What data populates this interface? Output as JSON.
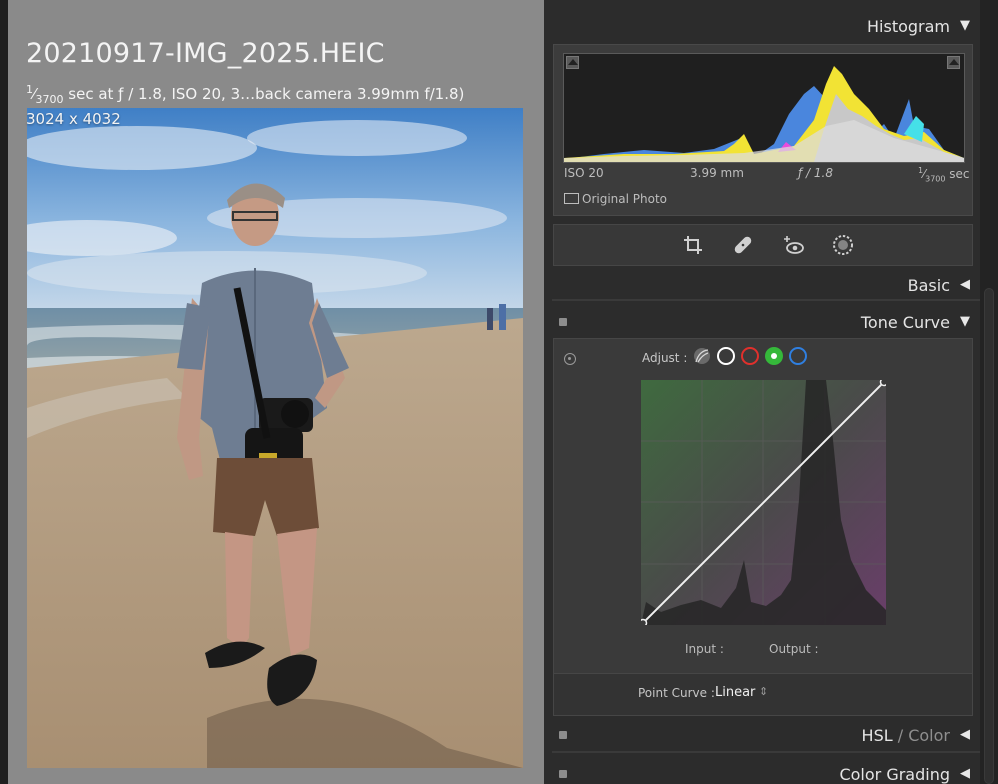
{
  "photo_info": {
    "filename": "20210917-IMG_2025.HEIC",
    "shutter_numerator": "1",
    "shutter_denominator": "3700",
    "exif_rest": " sec at ƒ / 1.8, ISO 20, 3…back camera 3.99mm f/1.8)",
    "dimensions": "3024 x 4032"
  },
  "panel": {
    "histogram": {
      "title": "Histogram",
      "iso": "ISO 20",
      "focal_length": "3.99 mm",
      "aperture": "ƒ / 1.8",
      "shutter_num": "1",
      "shutter_den": "3700",
      "shutter_unit": "sec",
      "original_photo_label": "Original Photo"
    },
    "tools": [
      "crop-icon",
      "healing-icon",
      "red-eye-icon",
      "masking-icon"
    ],
    "basic": {
      "title": "Basic"
    },
    "tone_curve": {
      "title": "Tone Curve",
      "adjust_label": "Adjust :",
      "channels": [
        {
          "name": "parametric",
          "color": "#9a9a9a"
        },
        {
          "name": "rgb",
          "color": "#ffffff"
        },
        {
          "name": "red",
          "color": "#e0302c"
        },
        {
          "name": "green",
          "color": "#35b83a",
          "selected": true
        },
        {
          "name": "blue",
          "color": "#2f7fe0"
        }
      ],
      "input_label": "Input :",
      "output_label": "Output :",
      "point_curve_label": "Point Curve :",
      "point_curve_value": "Linear"
    },
    "hsl": {
      "title_main": "HSL",
      "title_sep": " / ",
      "title_sub": "Color"
    },
    "color_grading": {
      "title": "Color Grading"
    }
  }
}
